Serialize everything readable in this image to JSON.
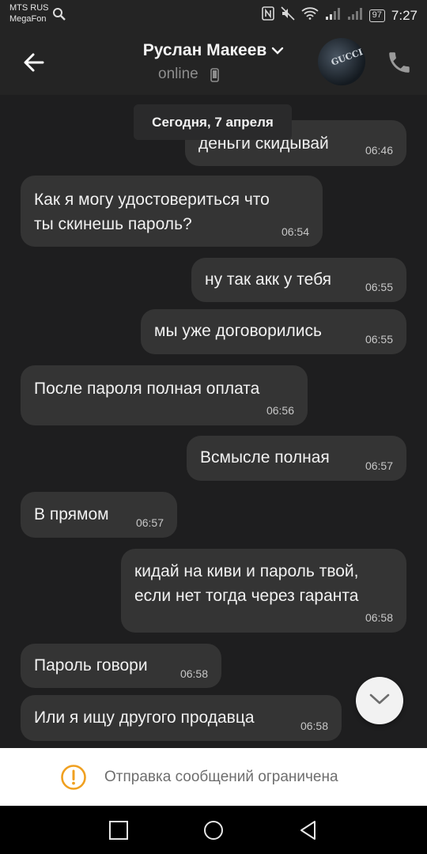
{
  "status_bar": {
    "carrier_1": "MTS RUS",
    "carrier_2": "MegaFon",
    "battery": "97",
    "time": "7:27"
  },
  "header": {
    "contact_name": "Руслан Макеев",
    "status": "online",
    "avatar_text": "GUCCI"
  },
  "chat": {
    "date_label": "Сегодня, 7 апреля",
    "messages": [
      {
        "text": "деньги скидывай",
        "time": "06:46",
        "dir": "out"
      },
      {
        "text": "Как я могу удостовериться что ты скинешь пароль?",
        "line1": "Как я могу удостовериться что",
        "line2": "ты скинешь пароль?",
        "time": "06:54",
        "dir": "in"
      },
      {
        "text": "ну так акк у тебя",
        "time": "06:55",
        "dir": "out"
      },
      {
        "text": "мы уже договорились",
        "time": "06:55",
        "dir": "out"
      },
      {
        "text": "После пароля полная оплата",
        "time": "06:56",
        "dir": "in"
      },
      {
        "text": "Всмысле полная",
        "time": "06:57",
        "dir": "out"
      },
      {
        "text": "В прямом",
        "time": "06:57",
        "dir": "in"
      },
      {
        "text": "кидай на киви и пароль твой, если нет тогда через гаранта",
        "line1": "кидай на киви и пароль твой,",
        "line2": "если нет тогда через гаранта",
        "time": "06:58",
        "dir": "out"
      },
      {
        "text": "Пароль говори",
        "time": "06:58",
        "dir": "in"
      },
      {
        "text": "Или я ищу другого продавца",
        "time": "06:58",
        "dir": "in"
      }
    ]
  },
  "notice": {
    "text": "Отправка сообщений ограничена"
  },
  "colors": {
    "background": "#1e1e1f",
    "bubble": "#343434",
    "notice_icon": "#f0a020"
  }
}
